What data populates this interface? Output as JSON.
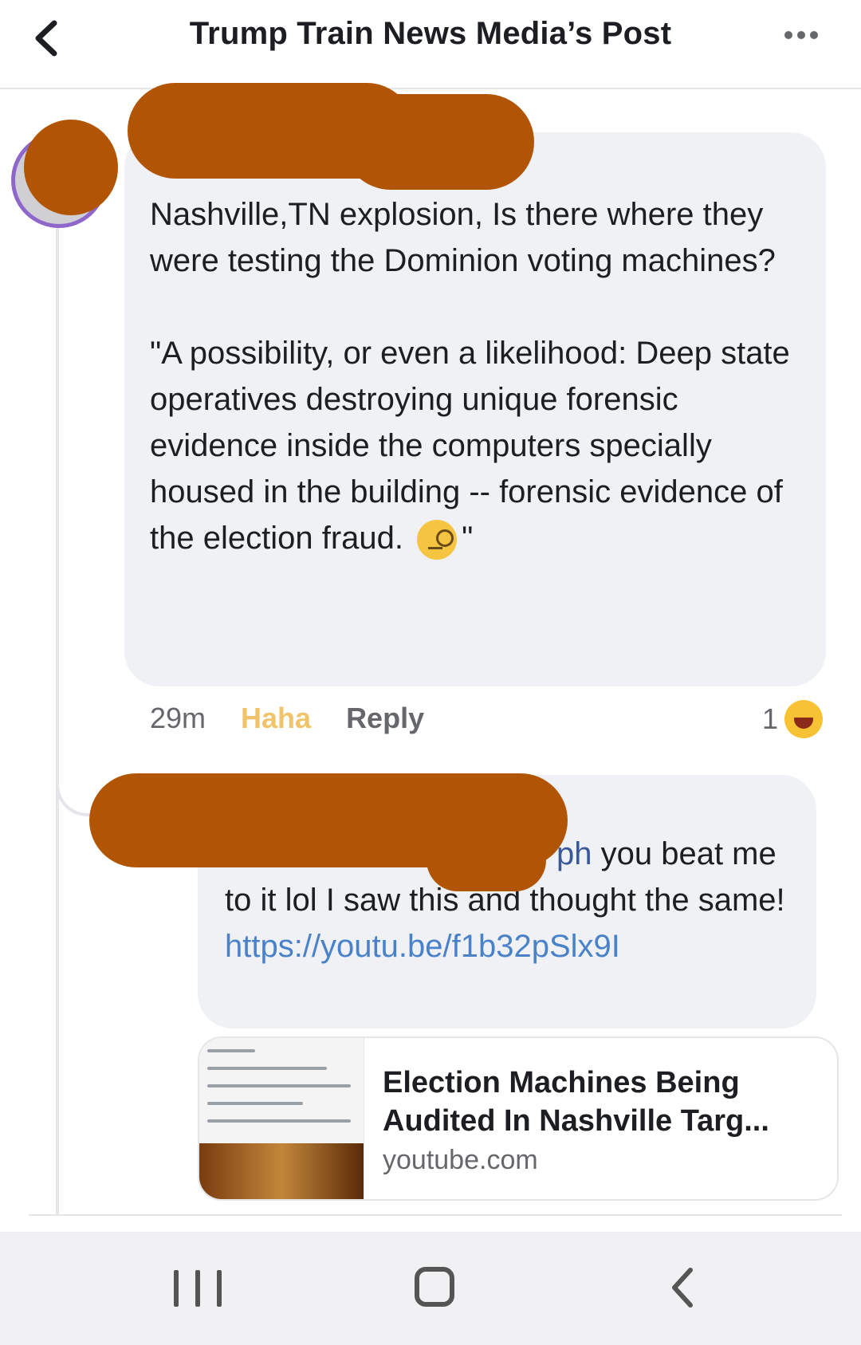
{
  "header": {
    "title": "Trump Train News Media’s Post",
    "back_icon": "chevron-left-icon",
    "more_icon": "more-dots-icon"
  },
  "comment1": {
    "paragraph1": "Nashville,TN explosion, Is there where they were testing the Dominion voting machines?",
    "paragraph2_open": "\"A possibility, or even a likelihood: Deep state operatives destroying unique forensic evidence inside the computers specially housed in the building -- forensic evidence of the election fraud.",
    "paragraph2_close": "\"",
    "emoji": "face-with-monocle-icon",
    "time": "29m",
    "reaction_label": "Haha",
    "reply_label": "Reply",
    "reaction_count": "1"
  },
  "comment2": {
    "mention_tail": "ph",
    "text": " you beat me to it lol I saw this and thought the same! ",
    "link": "https://youtu.be/f1b32pSlx9I"
  },
  "link_preview": {
    "title": "Election Machines Being Audited In Nashville Targ...",
    "domain": "youtube.com"
  },
  "colors": {
    "redaction": "#b15504",
    "bubble": "#eff1f4",
    "link": "#4a82c9",
    "haha": "#f0c46b"
  },
  "navbar": {
    "recents_icon": "recent-apps-icon",
    "home_icon": "home-icon",
    "back_icon": "back-icon"
  }
}
